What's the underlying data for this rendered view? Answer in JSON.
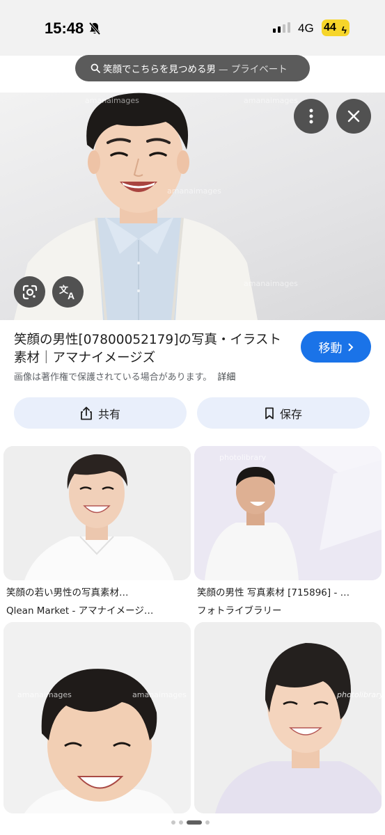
{
  "status_bar": {
    "time": "15:48",
    "network": "4G",
    "battery": "44"
  },
  "search": {
    "query": "笑顔でこちらを見つめる男",
    "mode": "— プライベート"
  },
  "result": {
    "title": "笑顔の男性[07800052179]の写真・イラスト素材｜アマナイメージズ",
    "visit_label": "移動",
    "copyright_notice": "画像は著作権で保護されている場合があります。",
    "details_label": "詳細",
    "share_label": "共有",
    "save_label": "保存",
    "watermark": "amanaimages"
  },
  "related": [
    {
      "title": "笑顔の若い男性の写真素材…",
      "source": "Qlean Market - アマナイメージ…"
    },
    {
      "title": "笑顔の男性 写真素材 [715896] - …",
      "source": "フォトライブラリー",
      "watermark": "photolibrary"
    },
    {
      "title": "",
      "source": ""
    },
    {
      "title": "",
      "source": ""
    }
  ],
  "icons": {
    "more": "more-vert-icon",
    "close": "close-icon",
    "lens": "lens-icon",
    "translate": "translate-icon",
    "share": "share-icon",
    "bookmark": "bookmark-icon",
    "search": "search-icon",
    "bell_off": "bell-off-icon"
  },
  "colors": {
    "accent": "#1a73e8",
    "tonal_button": "#e9effb",
    "battery": "#f6d52a"
  },
  "pager": {
    "pages": 4,
    "current": 3
  }
}
